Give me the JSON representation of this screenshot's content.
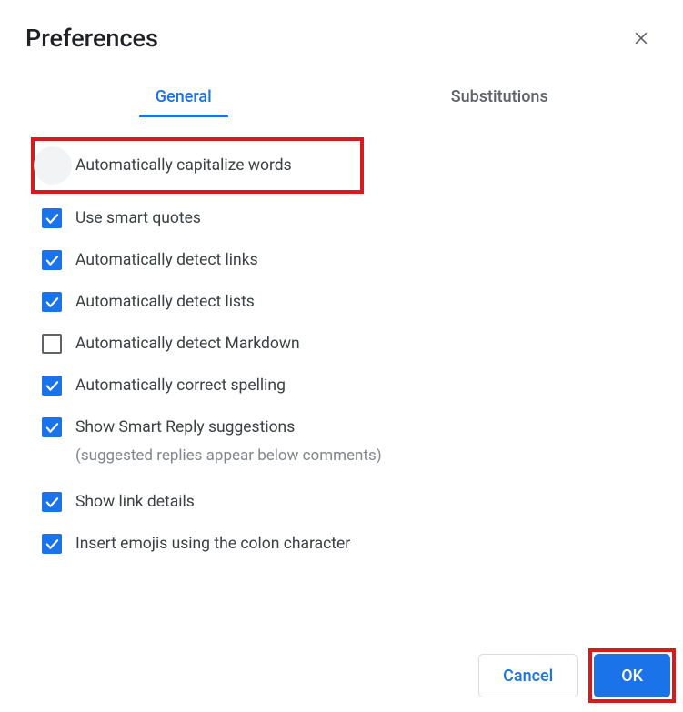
{
  "header": {
    "title": "Preferences"
  },
  "tabs": {
    "general": "General",
    "substitutions": "Substitutions"
  },
  "options": {
    "autoCapitalize": "Automatically capitalize words",
    "smartQuotes": "Use smart quotes",
    "detectLinks": "Automatically detect links",
    "detectLists": "Automatically detect lists",
    "detectMarkdown": "Automatically detect Markdown",
    "correctSpelling": "Automatically correct spelling",
    "smartReply": "Show Smart Reply suggestions",
    "smartReplySub": "(suggested replies appear below comments)",
    "linkDetails": "Show link details",
    "insertEmojis": "Insert emojis using the colon character"
  },
  "footer": {
    "cancel": "Cancel",
    "ok": "OK"
  }
}
